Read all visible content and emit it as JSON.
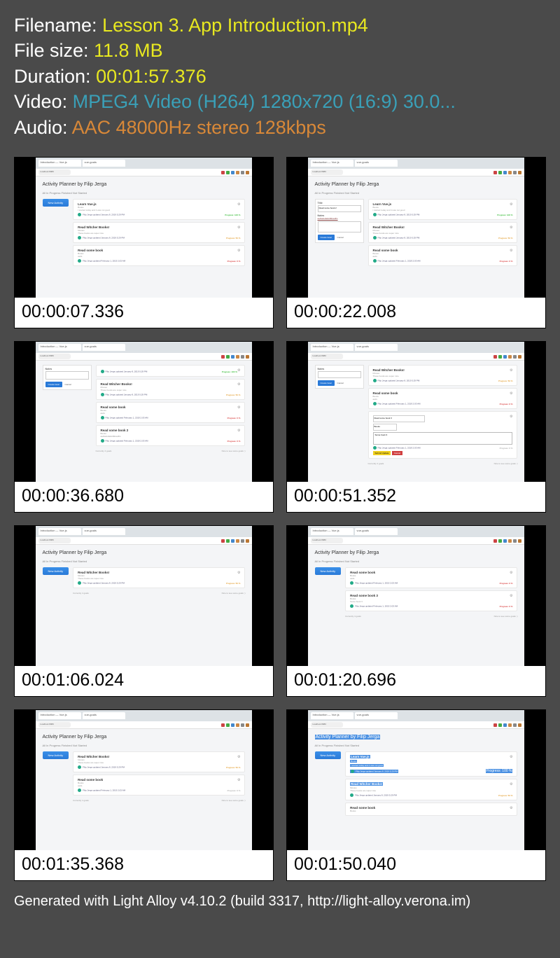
{
  "info": {
    "filename_label": "Filename: ",
    "filename_value": "Lesson 3. App Introduction.mp4",
    "filesize_label": "File size: ",
    "filesize_value": "11.8 MB",
    "duration_label": "Duration: ",
    "duration_value": "00:01:57.376",
    "video_label": "Video: ",
    "video_value": "MPEG4 Video (H264) 1280x720 (16:9) 30.0...",
    "audio_label": "Audio: ",
    "audio_value": "AAC 48000Hz stereo 128kbps"
  },
  "thumbs": {
    "t1": "00:00:07.336",
    "t2": "00:00:22.008",
    "t3": "00:00:36.680",
    "t4": "00:00:51.352",
    "t5": "00:01:06.024",
    "t6": "00:01:20.696",
    "t7": "00:01:35.368",
    "t8": "00:01:50.040"
  },
  "app": {
    "title": "Activity Planner by Filip Jerga",
    "tabs": "All   In Progress   Finished   Not Started",
    "new_activity": "New Activity",
    "tab1": "Introduction — Vue.js",
    "tab2": "vue-goals",
    "url": "localhost:8080",
    "cards": {
      "c1_title": "Learn Vue.js",
      "c1_sub": "Books",
      "c1_desc": "I started today and it was not good",
      "c1_auth": "Filip Jerga updated January 8, 2019 5:29 PM",
      "c1_prog": "Progress: 100 %",
      "c2_title": "Read Witcher Books!",
      "c2_sub": "Movies",
      "c2_desc": "These books are super nice",
      "c2_auth": "Filip Jerga updated January 8, 2019 5:29 PM",
      "c2_prog": "Progress: 50 %",
      "c3_title": "Read some book",
      "c3_sub": "Books",
      "c3_desc": "asds",
      "c3_auth": "Filip Jerga updated February 1, 2019 2:03 AM",
      "c3_prog": "Progress: 0 %",
      "c4_title": "Read some book 2",
      "c4_sub": "Books",
      "c4_desc": "asdlaksdaskldlksadhs",
      "c4_prog": "Progress: 0 %",
      "c5_title": "Read some book 3",
      "c5_sub": "Books",
      "c5_desc": "Some book 3",
      "c5_prog": "Progress: 0 %"
    },
    "side": {
      "title_label": "Title",
      "title_val": "Read some book 2",
      "notes_label": "Notes",
      "notes_val": "asdlaksdaskldlksadhs",
      "create": "Create Goal",
      "cancel": "Cancel"
    },
    "edit": {
      "submit": "Submit Update",
      "cancel": "Cancel"
    },
    "footer_left": "Currently 4 goals",
    "footer_right": "Nice to see some goals :)"
  },
  "footer": "Generated with Light Alloy v4.10.2 (build 3317, http://light-alloy.verona.im)"
}
